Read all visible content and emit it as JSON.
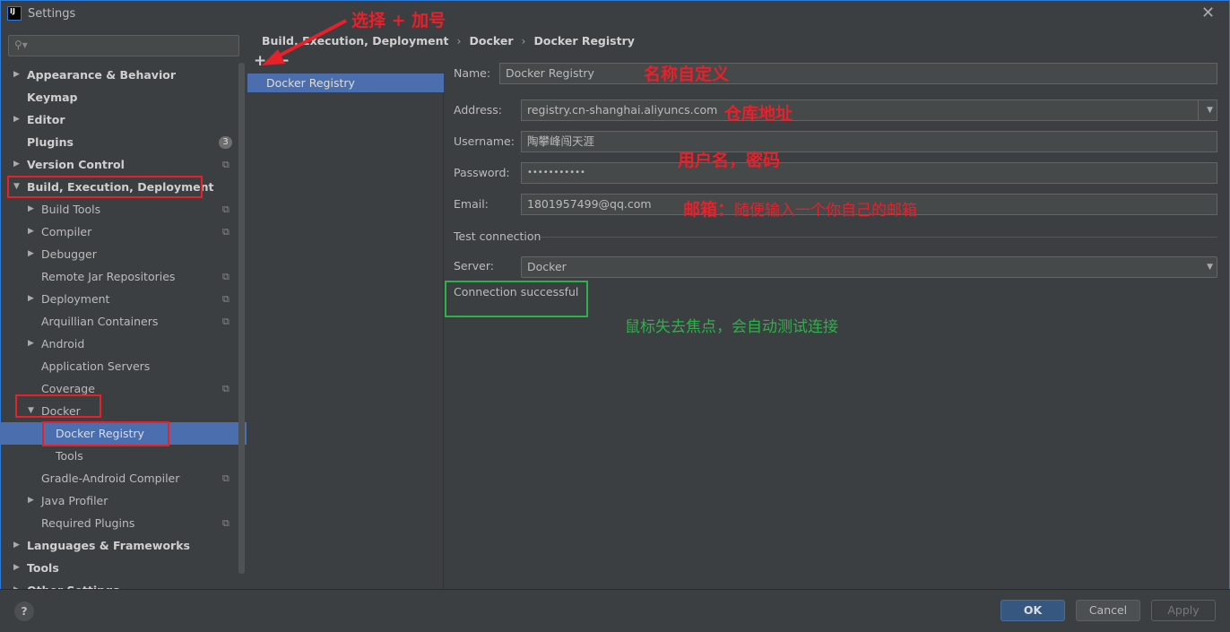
{
  "window": {
    "title": "Settings",
    "logo": "IJ",
    "close": "✕"
  },
  "search": {
    "placeholder": "",
    "icon": "search-icon"
  },
  "sidebar": {
    "items": [
      {
        "label": "Appearance & Behavior",
        "level": 0,
        "arrow": "▶",
        "bold": true
      },
      {
        "label": "Keymap",
        "level": 0,
        "bold": true
      },
      {
        "label": "Editor",
        "level": 0,
        "arrow": "▶",
        "bold": true
      },
      {
        "label": "Plugins",
        "level": 0,
        "bold": true,
        "badge": "3"
      },
      {
        "label": "Version Control",
        "level": 0,
        "arrow": "▶",
        "bold": true,
        "copy": true
      },
      {
        "label": "Build, Execution, Deployment",
        "level": 0,
        "arrow": "▼",
        "bold": true
      },
      {
        "label": "Build Tools",
        "level": 1,
        "arrow": "▶",
        "copy": true
      },
      {
        "label": "Compiler",
        "level": 1,
        "arrow": "▶",
        "copy": true
      },
      {
        "label": "Debugger",
        "level": 1,
        "arrow": "▶"
      },
      {
        "label": "Remote Jar Repositories",
        "level": 1,
        "copy": true
      },
      {
        "label": "Deployment",
        "level": 1,
        "arrow": "▶",
        "copy": true
      },
      {
        "label": "Arquillian Containers",
        "level": 1,
        "copy": true
      },
      {
        "label": "Android",
        "level": 1,
        "arrow": "▶"
      },
      {
        "label": "Application Servers",
        "level": 1
      },
      {
        "label": "Coverage",
        "level": 1,
        "copy": true
      },
      {
        "label": "Docker",
        "level": 1,
        "arrow": "▼"
      },
      {
        "label": "Docker Registry",
        "level": 2,
        "selected": true
      },
      {
        "label": "Tools",
        "level": 2
      },
      {
        "label": "Gradle-Android Compiler",
        "level": 1,
        "copy": true
      },
      {
        "label": "Java Profiler",
        "level": 1,
        "arrow": "▶"
      },
      {
        "label": "Required Plugins",
        "level": 1,
        "copy": true
      },
      {
        "label": "Languages & Frameworks",
        "level": 0,
        "arrow": "▶",
        "bold": true
      },
      {
        "label": "Tools",
        "level": 0,
        "arrow": "▶",
        "bold": true
      },
      {
        "label": "Other Settings",
        "level": 0,
        "arrow": "▶",
        "bold": true
      }
    ]
  },
  "breadcrumb": [
    "Build, Execution, Deployment",
    "Docker",
    "Docker Registry"
  ],
  "breadcrumb_sep": "›",
  "toolbar": {
    "add": "+",
    "remove": "−"
  },
  "registries": [
    "Docker Registry"
  ],
  "form": {
    "name_label": "Name:",
    "name_value": "Docker Registry",
    "address_label": "Address:",
    "address_value": "registry.cn-shanghai.aliyuncs.com",
    "username_label": "Username:",
    "username_value": "陶攀峰闯天涯",
    "password_label": "Password:",
    "password_value": "•••••••••••",
    "email_label": "Email:",
    "email_value": "1801957499@qq.com",
    "test_section": "Test connection",
    "server_label": "Server:",
    "server_value": "Docker",
    "status": "Connection successful"
  },
  "footer": {
    "help": "?",
    "ok": "OK",
    "cancel": "Cancel",
    "apply": "Apply"
  },
  "annotations": {
    "add": "选择 + 加号",
    "name": "名称自定义",
    "address": "仓库地址",
    "credentials": "用户名，密码",
    "email_bold": "邮箱：",
    "email_rest": "随便输入一个你自己的邮箱",
    "focus": "鼠标失去焦点，会自动测试连接"
  },
  "colors": {
    "accent": "#4b6eaf",
    "annotation_red": "#e8202a",
    "annotation_green": "#2eb04a"
  }
}
